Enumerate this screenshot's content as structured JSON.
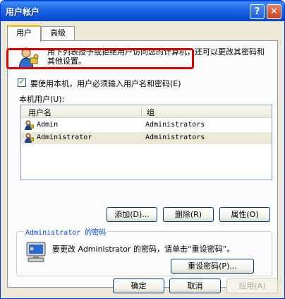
{
  "window": {
    "title": "用户帐户"
  },
  "titlebar": {
    "help": "?",
    "close": "✕"
  },
  "tabs": [
    {
      "label": "用户"
    },
    {
      "label": "高级"
    }
  ],
  "intro": {
    "text": "用下列表授予或拒绝用户访问您的计算机，还可以更改其密码和其他设置。"
  },
  "require_login": {
    "label": "要使用本机，用户必须输入用户名和密码(E)",
    "checked": true
  },
  "users_section": {
    "label": "本机用户(U):"
  },
  "users_table": {
    "columns": [
      "用户名",
      "组"
    ],
    "rows": [
      {
        "name": "Admin",
        "group": "Administrators"
      },
      {
        "name": "Administrator",
        "group": "Administrators",
        "selected": true
      }
    ]
  },
  "list_buttons": {
    "add": "添加(D)...",
    "remove": "删除(R)",
    "properties": "属性(O)"
  },
  "password_group": {
    "title": "Administrator 的密码",
    "text": "要更改 Administrator 的密码，请单击“重设密码”。",
    "reset_button": "重设密码(P)..."
  },
  "dialog_buttons": {
    "ok": "确定",
    "cancel": "取消",
    "apply": "应用(A)"
  },
  "colors": {
    "titlebar": "#0a5fde",
    "highlight": "#e00000",
    "link": "#0046d5"
  }
}
